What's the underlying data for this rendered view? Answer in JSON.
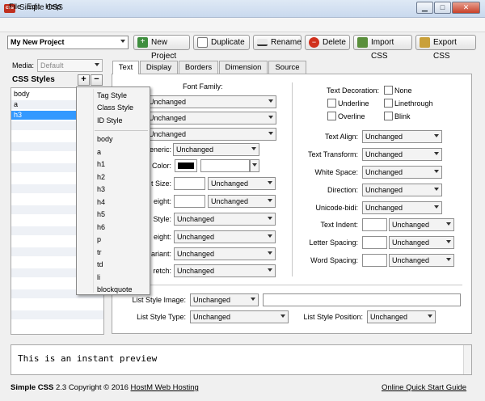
{
  "window": {
    "title": "Simple CSS",
    "icon_text": "css",
    "minimize": "▁",
    "maximize": "□",
    "close": "✕"
  },
  "menu": [
    "File",
    "Edit",
    "Help"
  ],
  "toolbar": {
    "project": "My New Project",
    "buttons": [
      "New Project",
      "Duplicate",
      "Rename",
      "Delete",
      "Import CSS",
      "Export CSS"
    ]
  },
  "left": {
    "media_label": "Media:",
    "media_value": "Default",
    "styles_label": "CSS Styles",
    "add_symbol": "+",
    "remove_symbol": "−",
    "items": [
      "body",
      "a",
      "h3"
    ],
    "selected": "h3"
  },
  "popup": {
    "section_items": [
      "Tag Style",
      "Class Style",
      "ID Style"
    ],
    "tag_items": [
      "body",
      "a",
      "h1",
      "h2",
      "h3",
      "h4",
      "h5",
      "h6",
      "p",
      "tr",
      "td",
      "li",
      "blockquote"
    ]
  },
  "tabs": [
    "Text",
    "Display",
    "Borders",
    "Dimension",
    "Source"
  ],
  "active_tab": "Text",
  "text_tab": {
    "font_family_label": "Font Family:",
    "unchanged": "Unchanged",
    "left_labels": [
      "eneric:",
      "Color:",
      "t Size:",
      "eight:",
      "Style:",
      "eight:",
      "ariant:",
      "retch:"
    ],
    "text_decoration_label": "Text Decoration:",
    "decorations": [
      "None",
      "Underline",
      "Linethrough",
      "Overline",
      "Blink"
    ],
    "right_labels": [
      "Text Align:",
      "Text Transform:",
      "White Space:",
      "Direction:",
      "Unicode-bidi:",
      "Text Indent:",
      "Letter Spacing:",
      "Word Spacing:"
    ],
    "list_style_image_label": "List Style Image:",
    "list_style_type_label": "List Style Type:",
    "list_style_position_label": "List Style Position:",
    "color_swatch": "#000000"
  },
  "preview": {
    "text": "This is an instant preview"
  },
  "footer": {
    "left_text": "Simple CSS 2.3 Copyright © 2016 ",
    "brand": "Simple CSS",
    "link": "HostM Web Hosting",
    "right_link": "Online Quick Start Guide"
  }
}
